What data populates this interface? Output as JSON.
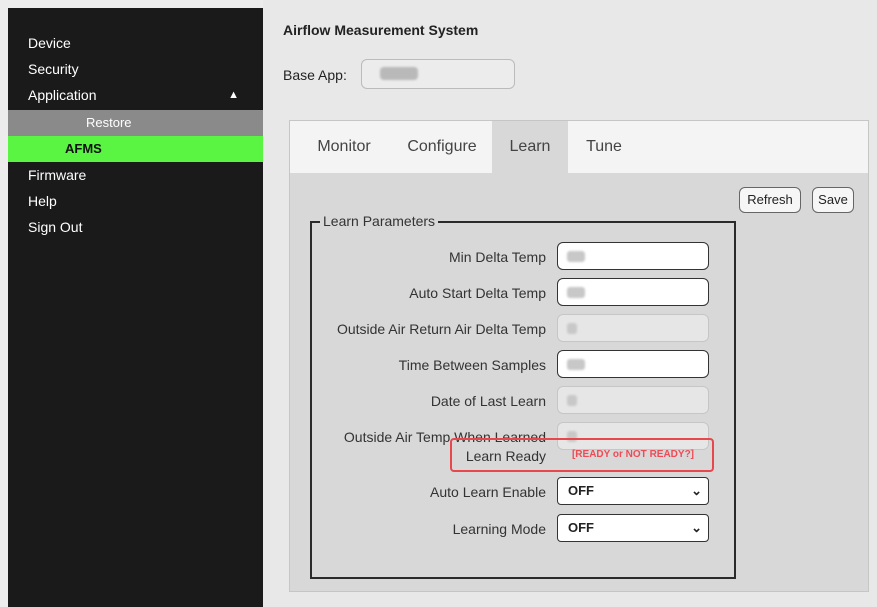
{
  "sidebar": {
    "device": "Device",
    "security": "Security",
    "application": "Application",
    "application_arrow": "▲",
    "restore": "Restore",
    "afms": "AFMS",
    "firmware": "Firmware",
    "help": "Help",
    "sign_out": "Sign Out"
  },
  "header": {
    "title": "Airflow Measurement System",
    "base_app_label": "Base App:"
  },
  "tabs": {
    "monitor": "Monitor",
    "configure": "Configure",
    "learn": "Learn",
    "tune": "Tune"
  },
  "actions": {
    "refresh": "Refresh",
    "save": "Save"
  },
  "learn_params": {
    "legend": "Learn Parameters",
    "min_delta_temp": "Min Delta Temp",
    "auto_start_delta_temp": "Auto Start Delta Temp",
    "outside_air_return_air_delta_temp": "Outside Air Return Air Delta Temp",
    "time_between_samples": "Time Between Samples",
    "date_of_last_learn": "Date of Last Learn",
    "outside_air_temp_when_learned": "Outside Air Temp When Learned",
    "learn_ready": "Learn Ready",
    "learn_ready_value": "[READY or NOT READY?]",
    "auto_learn_enable": "Auto Learn Enable",
    "auto_learn_enable_value": "OFF",
    "learning_mode": "Learning Mode",
    "learning_mode_value": "OFF"
  },
  "colors": {
    "sidebar_bg": "#1a1a1a",
    "active_item": "#59f542",
    "highlight_border": "#e8484b",
    "ready_text": "#f04a55"
  }
}
